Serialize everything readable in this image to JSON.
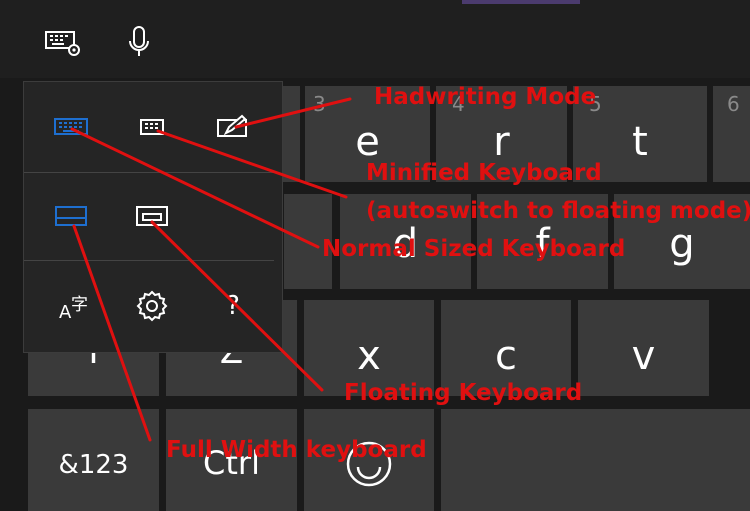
{
  "toolbar": {
    "settings_icon": "keyboard-settings-icon",
    "mic_icon": "microphone-icon"
  },
  "keys": {
    "e": {
      "label": "e",
      "num": "3"
    },
    "r": {
      "label": "r",
      "num": "4"
    },
    "t": {
      "label": "t",
      "num": "5"
    },
    "y_num": "6",
    "d": {
      "label": "d"
    },
    "f": {
      "label": "f"
    },
    "g": {
      "label": "g"
    },
    "x": {
      "label": "x"
    },
    "c": {
      "label": "c"
    },
    "v": {
      "label": "v"
    },
    "z": {
      "label": "Z"
    },
    "shift_partial": "T",
    "num_toggle": "&123",
    "ctrl": "Ctrl"
  },
  "menu": {
    "items": [
      {
        "id": "normal",
        "icon": "keyboard-normal-icon"
      },
      {
        "id": "minified",
        "icon": "keyboard-small-icon"
      },
      {
        "id": "handwriting",
        "icon": "pen-icon"
      },
      {
        "id": "full-width",
        "icon": "keyboard-full-width-icon"
      },
      {
        "id": "floating",
        "icon": "keyboard-floating-icon"
      },
      {
        "id": "language",
        "icon": "language-icon",
        "glyph_a": "A",
        "glyph_b": "字"
      },
      {
        "id": "settings",
        "icon": "gear-icon"
      },
      {
        "id": "help",
        "icon": "help-icon",
        "glyph": "?"
      }
    ]
  },
  "annotations": {
    "handwriting": "Hadwriting Mode",
    "minified_1": "Minified Keyboard",
    "minified_2": "(autoswitch to floating mode)",
    "normal": "Normal Sized Keyboard",
    "floating": "Floating Keyboard",
    "full_width": "Full Width keyboard"
  },
  "colors": {
    "annotation": "#e01010",
    "accent": "#1e6fd0",
    "key": "#3a3a3a",
    "background": "#1f1f1f"
  }
}
